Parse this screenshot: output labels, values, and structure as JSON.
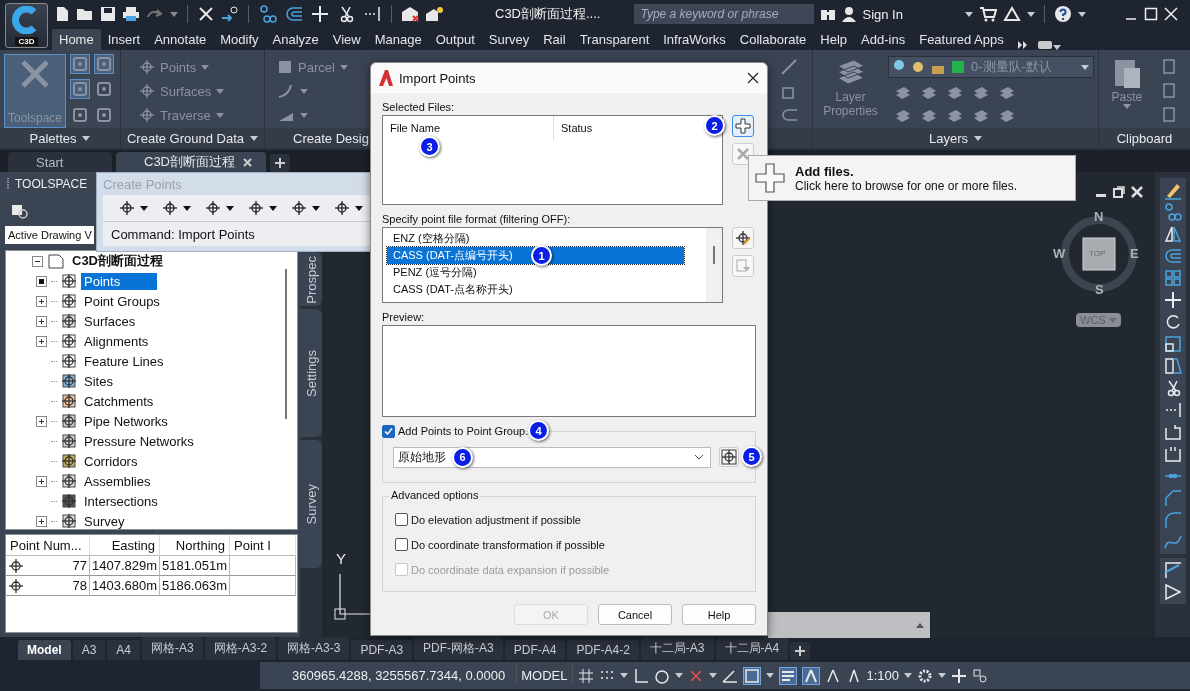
{
  "app": {
    "logo": "C3D",
    "title": "C3D剖断面过程....",
    "search": {
      "placeholder": "Type a keyword or phrase"
    },
    "sign_in": "Sign In"
  },
  "ribbon_tabs": [
    {
      "label": "Home",
      "selected": true
    },
    {
      "label": "Insert",
      "selected": false
    },
    {
      "label": "Annotate",
      "selected": false
    },
    {
      "label": "Modify",
      "selected": false
    },
    {
      "label": "Analyze",
      "selected": false
    },
    {
      "label": "View",
      "selected": false
    },
    {
      "label": "Manage",
      "selected": false
    },
    {
      "label": "Output",
      "selected": false
    },
    {
      "label": "Survey",
      "selected": false
    },
    {
      "label": "Rail",
      "selected": false
    },
    {
      "label": "Transparent",
      "selected": false
    },
    {
      "label": "InfraWorks",
      "selected": false
    },
    {
      "label": "Collaborate",
      "selected": false
    },
    {
      "label": "Help",
      "selected": false
    },
    {
      "label": "Add-ins",
      "selected": false
    },
    {
      "label": "Featured Apps",
      "selected": false
    }
  ],
  "ribbon": {
    "palettes": {
      "big": "Toolspace",
      "label": "Palettes"
    },
    "ground": {
      "items": [
        "Points",
        "Surfaces",
        "Traverse"
      ],
      "label": "Create Ground Data"
    },
    "design": {
      "item": "Parcel",
      "label": "Create Desig"
    },
    "layers": {
      "big": "Layer Properties",
      "layer": "0-测量队-默认",
      "label": "Layers"
    },
    "clipboard": {
      "big": "Paste",
      "label": "Clipboard"
    }
  },
  "doc_tabs": [
    {
      "label": "Start",
      "selected": false
    },
    {
      "label": "C3D剖断面过程",
      "selected": true
    }
  ],
  "toolspace": {
    "title": "TOOLSPACE",
    "view": "Active Drawing V",
    "tree": {
      "label": "C3D剖断面过程",
      "expanded": true,
      "children": [
        {
          "label": "Points",
          "kind": "marked",
          "selected": true
        },
        {
          "label": "Point Groups",
          "kind": "collapsed",
          "selected": false
        },
        {
          "label": "Surfaces",
          "kind": "collapsed",
          "selected": false
        },
        {
          "label": "Alignments",
          "kind": "collapsed",
          "selected": false
        },
        {
          "label": "Feature Lines",
          "kind": "leaf",
          "selected": false
        },
        {
          "label": "Sites",
          "kind": "leaf",
          "selected": false
        },
        {
          "label": "Catchments",
          "kind": "leaf",
          "selected": false
        },
        {
          "label": "Pipe Networks",
          "kind": "collapsed",
          "selected": false
        },
        {
          "label": "Pressure Networks",
          "kind": "leaf",
          "selected": false
        },
        {
          "label": "Corridors",
          "kind": "leaf",
          "selected": false
        },
        {
          "label": "Assemblies",
          "kind": "collapsed",
          "selected": false
        },
        {
          "label": "Intersections",
          "kind": "leaf",
          "selected": false
        },
        {
          "label": "Survey",
          "kind": "collapsed",
          "selected": false
        }
      ]
    },
    "table": {
      "columns": [
        "Point Num...",
        "Easting",
        "Northing",
        "Point I"
      ],
      "rows": [
        [
          "77",
          "1407.829m",
          "5181.051m"
        ],
        [
          "78",
          "1403.680m",
          "5186.063m"
        ]
      ]
    }
  },
  "side_tabs": [
    "Prospec",
    "Settings",
    "Survey"
  ],
  "create_points": {
    "title": "Create Points",
    "command": "Command: Import Points"
  },
  "viewcube": {
    "north": "N",
    "south": "S",
    "east": "E",
    "west": "W",
    "face": "TOP",
    "ucs": "WCS"
  },
  "ucs_axis": "Y",
  "dialog": {
    "title": "Import Points",
    "files_label": "Selected Files:",
    "file_columns": [
      "File Name",
      "Status"
    ],
    "file_badge": "3",
    "add_badge": "2",
    "format_label": "Specify point file format (filtering OFF):",
    "formats": [
      {
        "label": "ENZ (空格分隔)",
        "selected": false
      },
      {
        "label": "CASS (DAT-点编号开头)",
        "selected": true,
        "badge": "1"
      },
      {
        "label": "PENZ (逗号分隔)",
        "selected": false
      },
      {
        "label": "CASS (DAT-点名称开头)",
        "selected": false
      }
    ],
    "preview_label": "Preview:",
    "group": {
      "label": "Add Points to Point Group.",
      "checked": true,
      "badge": "4",
      "value": "原始地形",
      "value_badge": "6",
      "button_badge": "5"
    },
    "advanced": {
      "label": "Advanced options",
      "options": [
        {
          "label": "Do elevation adjustment if possible",
          "checked": false,
          "disabled": false
        },
        {
          "label": "Do coordinate transformation if possible",
          "checked": false,
          "disabled": false
        },
        {
          "label": "Do coordinate data expansion if possible",
          "checked": false,
          "disabled": true
        }
      ]
    },
    "buttons": [
      {
        "label": "OK",
        "disabled": true
      },
      {
        "label": "Cancel",
        "disabled": false
      },
      {
        "label": "Help",
        "disabled": false
      }
    ]
  },
  "tooltip": {
    "title": "Add files.",
    "text": "Click here to browse for one or more files."
  },
  "layout_tabs": [
    {
      "label": "Model",
      "selected": true
    },
    {
      "label": "A3",
      "selected": false
    },
    {
      "label": "A4",
      "selected": false
    },
    {
      "label": "网格-A3",
      "selected": false
    },
    {
      "label": "网格-A3-2",
      "selected": false
    },
    {
      "label": "网格-A3-3",
      "selected": false
    },
    {
      "label": "PDF-A3",
      "selected": false
    },
    {
      "label": "PDF-网格-A3",
      "selected": false
    },
    {
      "label": "PDF-A4",
      "selected": false
    },
    {
      "label": "PDF-A4-2",
      "selected": false
    },
    {
      "label": "十二局-A3",
      "selected": false
    },
    {
      "label": "十二局-A4",
      "selected": false
    }
  ],
  "status": {
    "coords": "360965.4288, 3255567.7344, 0.0000",
    "model": "MODEL",
    "scale": "1:100"
  }
}
